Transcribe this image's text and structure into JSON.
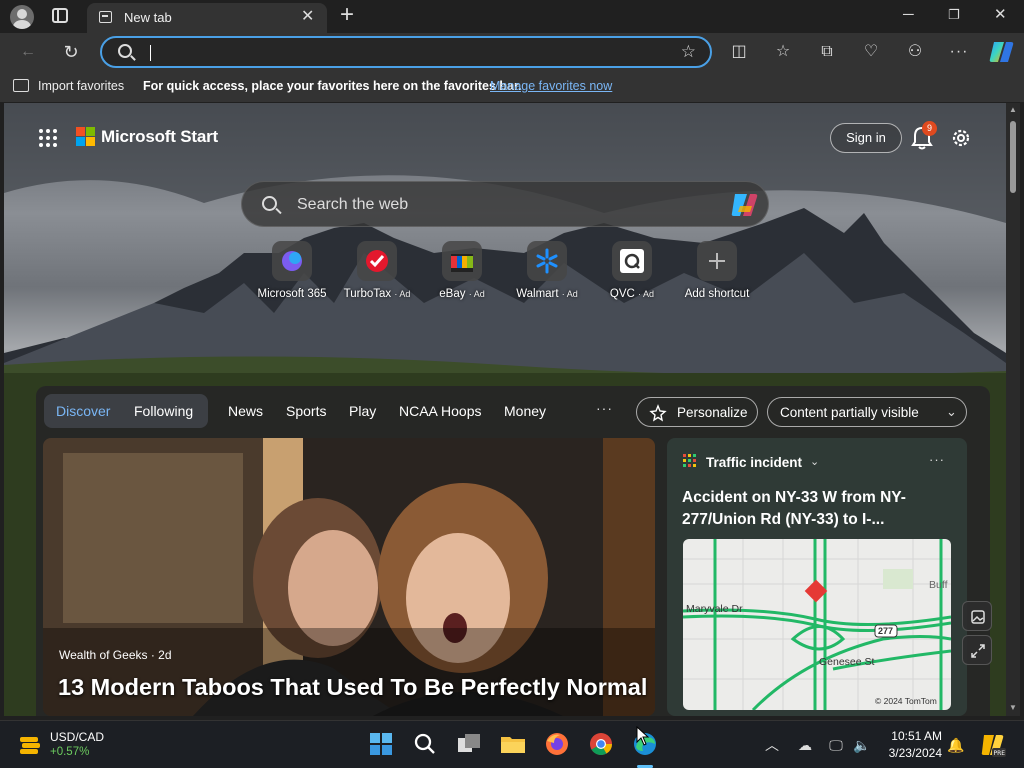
{
  "browser": {
    "tab_title": "New tab",
    "address_value": "",
    "favorites_bar": {
      "import_label": "Import favorites",
      "message": "For quick access, place your favorites here on the favorites bar.",
      "link": "Manage favorites now"
    }
  },
  "ntp": {
    "brand": "Microsoft Start",
    "signin": "Sign in",
    "notification_count": "9",
    "search_placeholder": "Search the web",
    "shortcuts": [
      {
        "label": "Microsoft 365",
        "ad": ""
      },
      {
        "label": "TurboTax",
        "ad": "· Ad"
      },
      {
        "label": "eBay",
        "ad": "· Ad"
      },
      {
        "label": "Walmart",
        "ad": "· Ad"
      },
      {
        "label": "QVC",
        "ad": "· Ad"
      },
      {
        "label": "Add shortcut",
        "ad": ""
      }
    ],
    "feed_tabs": {
      "active": "Discover",
      "second": "Following"
    },
    "nav": [
      "News",
      "Sports",
      "Play",
      "NCAA Hoops",
      "Money"
    ],
    "more": "···",
    "personalize": "Personalize",
    "content_visibility": "Content partially visible",
    "hero": {
      "source": "Wealth of Geeks · 2d",
      "headline": "13 Modern Taboos That Used To Be Perfectly Normal"
    },
    "traffic_card": {
      "header": "Traffic incident",
      "title": "Accident on NY-33 W from NY-277/Union Rd (NY-33) to I-...",
      "map_labels": {
        "street1": "Maryvale Dr",
        "street2": "Genesee St",
        "route": "277",
        "place": "Buff",
        "credit": "© 2024 TomTom"
      }
    }
  },
  "taskbar": {
    "stock_symbol": "USD/CAD",
    "stock_change": "+0.57%",
    "time": "10:51 AM",
    "date": "3/23/2024"
  }
}
